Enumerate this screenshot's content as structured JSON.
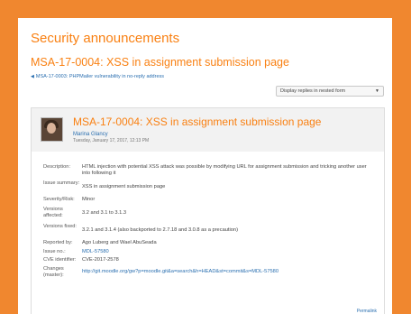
{
  "page": {
    "heading": "Security announcements",
    "discussion_title": "MSA-17-0004: XSS in assignment submission page",
    "prev_discussion": "MSA-17-0003: PHPMailer vulnerability in no-reply address",
    "display_mode": "Display replies in nested form"
  },
  "post": {
    "subject": "MSA-17-0004: XSS in assignment submission page",
    "author": "Marina Glancy",
    "date": "Tuesday, January 17, 2017, 12:13 PM",
    "fields": [
      {
        "key": "Description:",
        "value": "HTML injection with potential XSS attack was possible by modifying URL for assignment submission and tricking another user into following it"
      },
      {
        "key": "Issue summary:",
        "value": "XSS in assignment submission page"
      },
      {
        "key": "Severity/Risk:",
        "value": "Minor"
      },
      {
        "key": "Versions affected:",
        "value": "3.2 and 3.1 to 3.1.3"
      },
      {
        "key": "Versions fixed:",
        "value": "3.2.1 and 3.1.4 (also backported to 2.7.18 and 3.0.8 as a precaution)"
      },
      {
        "key": "Reported by:",
        "value": "Ago Luberg and Wael AbuSeada"
      },
      {
        "key": "Issue no.:",
        "value": "MDL-57580"
      },
      {
        "key": "CVE identifier:",
        "value": "CVE-2017-2578"
      },
      {
        "key": "Changes (master):",
        "value": "http://git.moodle.org/gw?p=moodle.git&a=search&h=HEAD&st=commit&s=MDL-57580"
      }
    ],
    "permalink": "Permalink"
  }
}
